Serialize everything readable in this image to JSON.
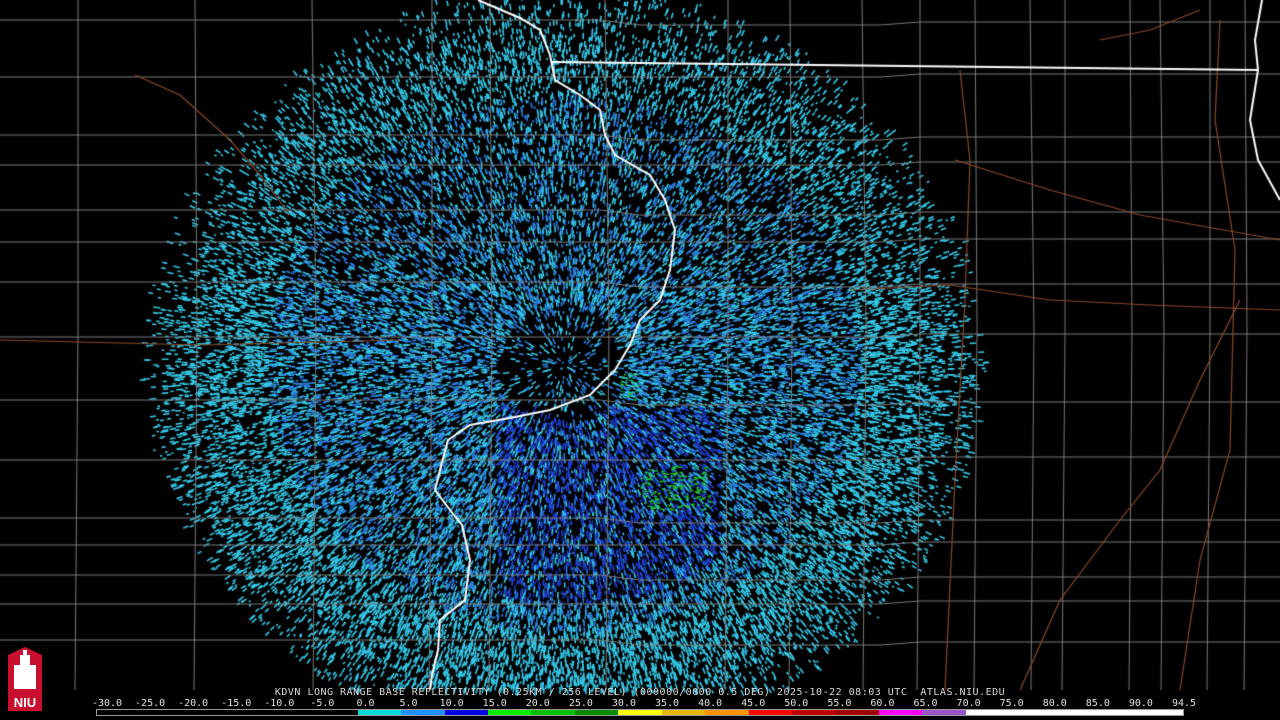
{
  "caption": "KDVN LONG RANGE BASE REFLECTIVITY (0.25KM / 256 LEVEL) (000000/0000 0.5 DEG) 2025-10-22 08:03 UTC  ATLAS.NIU.EDU",
  "logo": {
    "text": "NIU",
    "icon": "university-tower-icon",
    "color": "#c8102e"
  },
  "colorbar": {
    "ticks": [
      "-30.0",
      "-25.0",
      "-20.0",
      "-15.0",
      "-10.0",
      "-5.0",
      "0.0",
      "5.0",
      "10.0",
      "15.0",
      "20.0",
      "25.0",
      "30.0",
      "35.0",
      "40.0",
      "45.0",
      "50.0",
      "55.0",
      "60.0",
      "65.0",
      "70.0",
      "75.0",
      "80.0",
      "85.0",
      "90.0",
      "94.5"
    ],
    "colors": [
      "#000000",
      "#000000",
      "#000000",
      "#000000",
      "#000000",
      "#000000",
      "#00d8d8",
      "#1e90ff",
      "#0000e0",
      "#00f000",
      "#00c000",
      "#008a00",
      "#ffff00",
      "#e6b800",
      "#ff9000",
      "#ff0000",
      "#c00000",
      "#a00000",
      "#ff00ff",
      "#9955c9",
      "#ffffff",
      "#ffffff",
      "#ffffff",
      "#ffffff",
      "#ffffff"
    ]
  },
  "colors": {
    "background": "#000000",
    "county_lines": "#7a7a7a",
    "state_lines": "#ffffff",
    "highways": "#8a4a2a",
    "echo_light": "#35c8e8",
    "echo_mid": "#2b7fe0",
    "echo_dark": "#1f3fd0",
    "echo_green": "#22c22a"
  },
  "radar": {
    "site": "KDVN",
    "radius_km": 460
  }
}
